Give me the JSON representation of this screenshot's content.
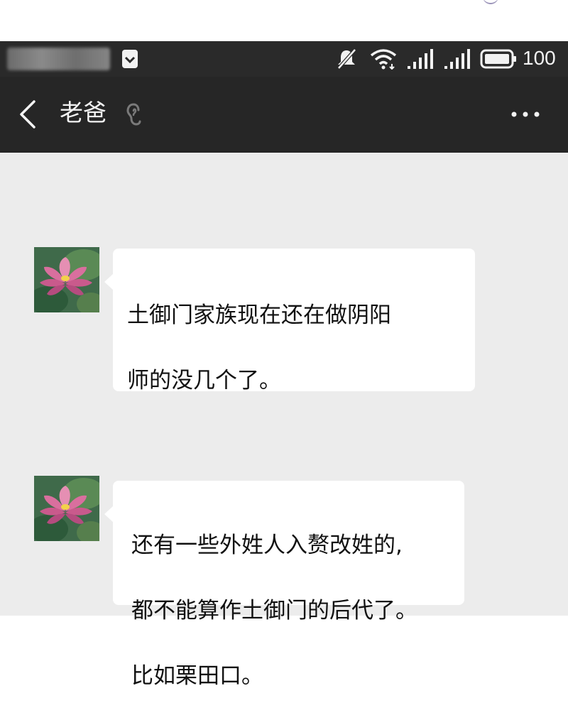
{
  "status_bar": {
    "battery_level": "100",
    "icons": [
      "sim-lock-icon",
      "mute-icon",
      "wifi-icon",
      "signal-icon",
      "signal-icon",
      "battery-icon"
    ]
  },
  "nav_bar": {
    "back_icon": "chevron-left-icon",
    "contact_name": "老爸",
    "ear_icon": "ear-icon",
    "more_icon": "more-dots-icon"
  },
  "messages": [
    {
      "sender_avatar": "lotus-avatar",
      "lines": [
        "土御门家族现在还在做阴阳",
        "师的没几个了。"
      ]
    },
    {
      "sender_avatar": "lotus-avatar",
      "lines": [
        "还有一些外姓人入赘改姓的,",
        "都不能算作土御门的后代了。",
        "比如栗田口。"
      ]
    }
  ],
  "colors": {
    "status_bar_bg": "#2a2a2a",
    "nav_bar_bg": "#262626",
    "chat_bg": "#ececec",
    "bubble_bg": "#ffffff",
    "text": "#111111"
  }
}
